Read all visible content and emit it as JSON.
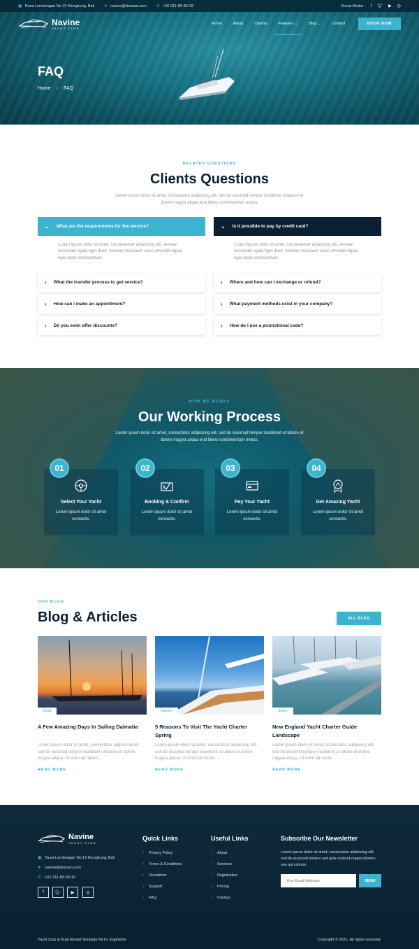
{
  "topbar": {
    "address": "Nusa Lembongan No.19 Klungkung, Bali",
    "email": "navine@domain.com",
    "phone": "+62-311-89-90-19",
    "social_label": "Social Media :"
  },
  "brand": {
    "name": "Navine",
    "tagline": "YACHT CLUB"
  },
  "nav": {
    "items": [
      "Home",
      "About",
      "Charter",
      "Features",
      "Blog",
      "Contact"
    ],
    "book_label": "BOOK NOW"
  },
  "hero": {
    "title": "FAQ",
    "breadcrumb": [
      "Home",
      "FAQ"
    ]
  },
  "faq": {
    "eyebrow": "RELATED QUESTIONS",
    "title": "Clients Questions",
    "subtitle": "Lorem ipsum dolor sit amet, consectetur adipiscing elit, sed do eiusmod tempor incididunt ut labore et dolore magna aliqua erat libero condimentum metus.",
    "answer": "Lorem ipsum dolor sit amet, consectetuer adipiscing elit. Aenean commodo ligula eget dolor. Aenean massaum socis ommodo ligula eget dolor consectetuer.",
    "left": [
      "What are the requirements for the service?",
      "What the transfer process to get service?",
      "How can i make an appointment?",
      "Do you even offer discounts?"
    ],
    "right": [
      "Is it possible to pay by credit card?",
      "Where and how can I exchange or refund?",
      "What payment methods exist in your company?",
      "How do I use a promotional code?"
    ]
  },
  "process": {
    "eyebrow": "HOW WE WORKS",
    "title": "Our Working Process",
    "subtitle": "Lorem ipsum dolor sit amet, consectetur adipiscing elit, sed do eiusmod tempor incididunt ut labore et dolore magna aliqua erat libero condimentum metus.",
    "steps": [
      {
        "num": "01",
        "title": "Select Your Yacht",
        "desc": "Lorem ipsum dolor sit amet consecte.",
        "icon": "steering-wheel-icon"
      },
      {
        "num": "02",
        "title": "Booking & Confirm",
        "desc": "Lorem ipsum dolor sit amet consecte.",
        "icon": "check-sign-icon"
      },
      {
        "num": "03",
        "title": "Pay Your Yacht",
        "desc": "Lorem ipsum dolor sit amet consecte.",
        "icon": "credit-card-icon"
      },
      {
        "num": "04",
        "title": "Get Amazing Yacht",
        "desc": "Lorem ipsum dolor sit amet consecte.",
        "icon": "award-badge-icon"
      }
    ]
  },
  "blog": {
    "eyebrow": "OUR BLOG",
    "title": "Blog & Articles",
    "all_label": "ALL BLOG",
    "posts": [
      {
        "tag": "Boat",
        "title": "A Few Amazing Days In Sailing Dalmatia",
        "excerpt": "Lorem ipsum dolor sit amet, consectetur adipiscing elit, sed do eiusmod tempor incididunt ut labore et dolore magna aliqua. Ut enim ad minim...",
        "read_more": "READ MORE"
      },
      {
        "tag": "Marine",
        "title": "5 Reasons To Visit The Yacht Charter Spring",
        "excerpt": "Lorem ipsum dolor sit amet, consectetur adipiscing elit, sed do eiusmod tempor incididunt ut labore et dolore magna aliqua. Ut enim ad minim...",
        "read_more": "READ MORE"
      },
      {
        "tag": "Sailor",
        "title": "New England Yacht Charter Guide Landscape",
        "excerpt": "Lorem ipsum dolor sit amet, consectetur adipiscing elit, sed do eiusmod tempor incididunt ut labore et dolore magna aliqua. Ut enim ad minim...",
        "read_more": "READ MORE"
      }
    ]
  },
  "footer": {
    "address": "Nusa Lembongan No.19 Klungkung, Bali",
    "email": "navine@domain.com",
    "phone": "+62-311-89-90-19",
    "quick_title": "Quick Links",
    "quick_links": [
      "Privacy Policy",
      "Terms & Conditions",
      "Disclaimer",
      "Support",
      "FAQ"
    ],
    "useful_title": "Useful Links",
    "useful_links": [
      "About",
      "Services",
      "Registration",
      "Pricing",
      "Contact"
    ],
    "newsletter_title": "Subscribe Our Newsletter",
    "newsletter_text": "Lorem ipsum dolor sit amet, consectetur adipiscing elit, sed do eiusmod tempor sed quis nostrud magni dolores eos qui ratione.",
    "email_placeholder": "Your Email Address",
    "send_label": "SEND",
    "credit": "Yacht Club & Boat Rental Template Kit by Jegtheme",
    "copyright": "Copyright © 2021. All rights reserved."
  },
  "colors": {
    "accent": "#3cb4cf",
    "dark": "#0b2033",
    "footer": "#0d2535"
  }
}
